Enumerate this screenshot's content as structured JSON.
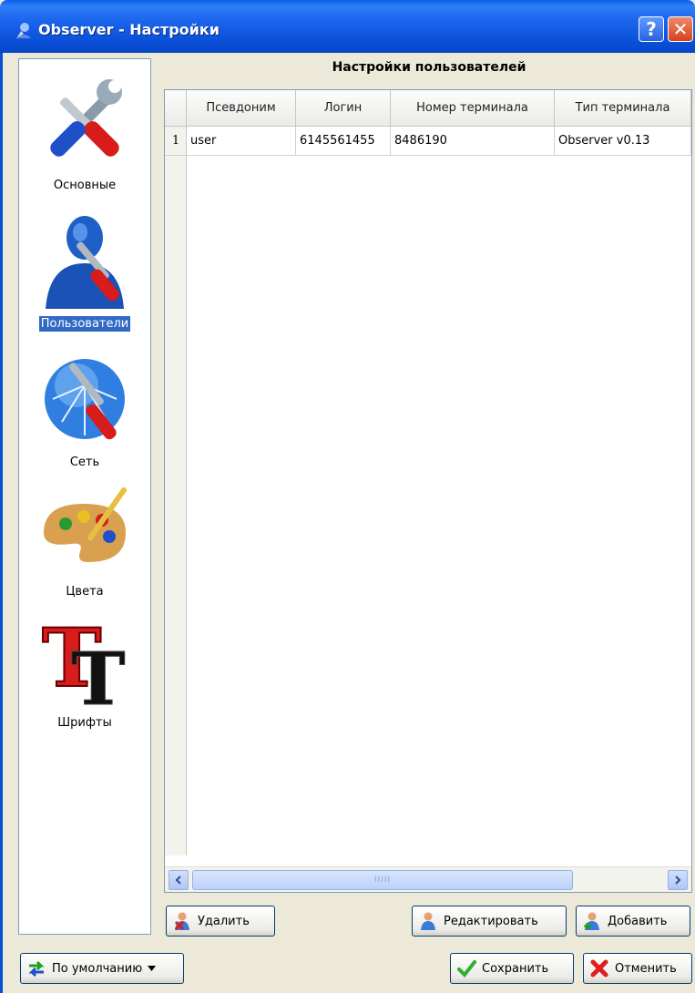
{
  "window": {
    "title": "Observer - Настройки",
    "help_glyph": "?",
    "close_glyph": "✕"
  },
  "sidebar": {
    "items": [
      {
        "label": "Основные",
        "icon": "tools-icon"
      },
      {
        "label": "Пользователи",
        "icon": "user-icon",
        "selected": true
      },
      {
        "label": "Сеть",
        "icon": "network-globe-icon"
      },
      {
        "label": "Цвета",
        "icon": "palette-icon"
      },
      {
        "label": "Шрифты",
        "icon": "fonts-icon"
      }
    ]
  },
  "users": {
    "section_title": "Настройки пользователей",
    "columns": [
      "Псевдоним",
      "Логин",
      "Номер терминала",
      "Тип терминала"
    ],
    "rows": [
      {
        "num": "1",
        "cells": [
          "user",
          "6145561455",
          "8486190",
          "Observer v0.13"
        ]
      }
    ],
    "scroll_grip": "IIIII"
  },
  "actions": {
    "delete": "Удалить",
    "edit": "Редактировать",
    "add": "Добавить"
  },
  "footer": {
    "defaults": "По умолчанию",
    "save": "Сохранить",
    "cancel": "Отменить"
  },
  "colors": {
    "titlebar": "#0a4fd8",
    "selection": "#316ac5",
    "border": "#7f9db9"
  }
}
